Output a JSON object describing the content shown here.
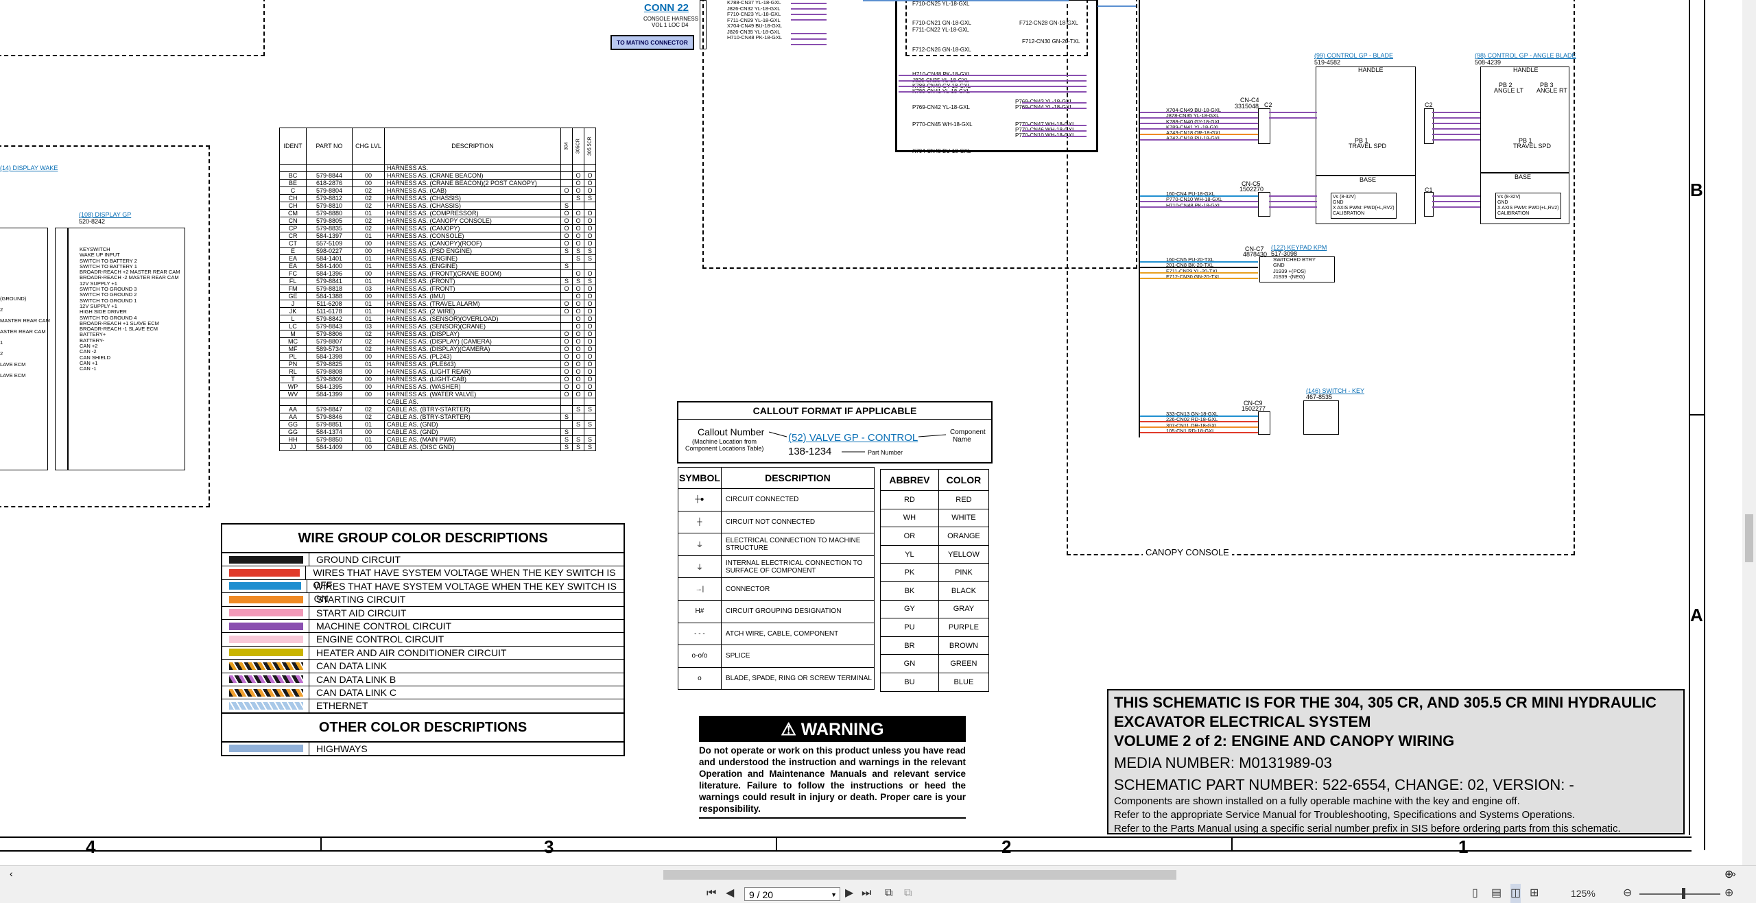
{
  "conn22": {
    "title": "CONN 22",
    "sub": [
      "CONSOLE HARNESS",
      "VOL 1 LOC D4"
    ],
    "button": "TO MATING CONNECTOR"
  },
  "mid_wires": [
    "F710-CN25 YL-18-GXL",
    "F710-CN21 GN-18-GXL",
    "F712-CN28 GN-18-GXL",
    "F711-CN22 YL-18-GXL",
    "F712-CN30 GN-20-TXL",
    "F712-CN26 GN-18-GXL",
    "H710-CN48 PK-18-GXL",
    "J826-CN35 YL-18-GXL",
    "K788-CN40 GY-18-GXL",
    "K789-CN41 YL-18-GXL",
    "P769-CN42 YL-18-GXL",
    "P769-CN43 YL-18-GXL",
    "P769-CN44 YL-18-GXL",
    "P770-CN45 WH-18-GXL",
    "P770-CN47 WH-18-GXL",
    "P770-CN46 WH-18-GXL",
    "P770-CN10 WH-18-GXL",
    "X704-CN49 BU-18-GXL"
  ],
  "conn22_wires": [
    "K788-CN37 YL-18-GXL",
    "J826-CN32 YL-18-GXL",
    "F710-CN23 YL-18-GXL",
    "F711-CN29 YL-18-GXL",
    "X704-CN49 BU-18-GXL",
    "J826-CN35 YL-18-GXL",
    "H710-CN48 PK-18-GXL"
  ],
  "blade": {
    "title": "(99) CONTROL GP - BLADE",
    "part": "519-4582",
    "handle": "HANDLE",
    "base": "BASE",
    "pb": "PB 1",
    "tsw": "TRAVEL SPD"
  },
  "angle": {
    "title": "(98) CONTROL GP - ANGLE BLADE",
    "part": "508-4239",
    "handle": "HANDLE",
    "base": "BASE",
    "pb2": "PB 2",
    "pb2b": "ANGLE LT",
    "pb3": "PB 3",
    "pb3b": "ANGLE RT",
    "pb1": "PB 1",
    "tsw": "TRAVEL SPD"
  },
  "base_lines": [
    "Vs (8-32V)",
    "GND",
    "X AXIS PWM: PWD(+L,RV2)",
    "CALIBRATION"
  ],
  "cn_c4": {
    "id": "CN-C4",
    "part": "3315048",
    "c": "C2",
    "wires": [
      "X704-CN49 BU-18-GXL",
      "J878-CN35 YL-18-GXL",
      "K788-CN40 GY-18-GXL",
      "K789-CN41 YL-18-GXL",
      "A743-CN18 OR-18-GXL",
      "A742-CN18 PU-18-GXL"
    ]
  },
  "cn_c5": {
    "id": "CN-C5",
    "part": "1502270",
    "c": "C1",
    "wires": [
      "160-CN4 PU-18-GXL",
      "P770-CN10 WH-18-GXL",
      "H710-CN48 PK-18-GXL"
    ]
  },
  "keypad": {
    "title": "(122) KEYPAD KPM",
    "part": "517-3098",
    "id": "CN-C7",
    "part2": "4878430",
    "wires": [
      "160-CN5 PU-20-TXL",
      "201-CN8 BK-20-TXL",
      "F711-CN29 YL-20-TXL",
      "F712-CN30 GN-20-TXL"
    ],
    "pins": [
      "SWITCHED BTRY",
      "GND",
      "J1939 +(POS)",
      "J1939 -(NEG)"
    ]
  },
  "key": {
    "title": "(146) SWITCH - KEY",
    "part": "467-8535",
    "id": "CN-C9",
    "part2": "1502277",
    "wires": [
      "333-CN13 GN-18-GXL",
      "226-CN02 RD-18-GXL",
      "307-CN11 OR-18-GXL",
      "105-CN1 RD-18-GXL"
    ]
  },
  "canopy_label": "CANOPY CONSOLE",
  "left_panel": {
    "wake": "(14) DISPLAY WAKE",
    "display_title": "(108) DISPLAY GP",
    "display_part": "520-8242",
    "pins": [
      "KEYSWITCH",
      "WAKE UP INPUT",
      "SWITCH TO BATTERY 2",
      "SWITCH TO BATTERY 1",
      "BROADR-REACH +2 MASTER REAR CAM",
      "BROADR-REACH -2 MASTER REAR CAM",
      "12V SUPPLY +1",
      "SWITCH TO GROUND 3",
      "SWITCH TO GROUND 2",
      "SWITCH TO GROUND 1",
      "12V SUPPLY +1",
      "HIGH SIDE DRIVER",
      "SWITCH TO GROUND 4",
      "BROADR-REACH +1 SLAVE ECM",
      "BROADR-REACH -1 SLAVE ECM",
      "BATTERY+",
      "BATTERY-",
      "CAN +2",
      "CAN -2",
      "CAN SHIELD",
      "CAN +1",
      "CAN -1"
    ],
    "left_frags": [
      "(GROUND)",
      "2",
      "MASTER REAR CAM",
      "ASTER REAR CAM",
      "1",
      "2",
      "LAVE ECM",
      "LAVE ECM"
    ]
  },
  "parts_table": {
    "headers": [
      "IDENT",
      "PART NO",
      "CHG LVL",
      "DESCRIPTION",
      "304",
      "305CR",
      "305.5CR"
    ],
    "rows": [
      [
        "",
        "",
        "",
        "HARNESS AS.",
        "",
        "",
        ""
      ],
      [
        "BC",
        "579-8844",
        "00",
        "HARNESS AS. (CRANE BEACON)",
        "",
        "O",
        "O"
      ],
      [
        "BE",
        "618-2876",
        "00",
        "HARNESS AS. (CRANE BEACON)(2 POST CANOPY)",
        "",
        "O",
        "O"
      ],
      [
        "C",
        "579-8804",
        "02",
        "HARNESS AS. (CAB)",
        "O",
        "O",
        "O"
      ],
      [
        "CH",
        "579-8812",
        "02",
        "HARNESS AS. (CHASSIS)",
        "",
        "S",
        "S"
      ],
      [
        "CH",
        "579-8810",
        "02",
        "HARNESS AS. (CHASSIS)",
        "S",
        "",
        ""
      ],
      [
        "CM",
        "579-8880",
        "01",
        "HARNESS AS. (COMPRESSOR)",
        "O",
        "O",
        "O"
      ],
      [
        "CN",
        "579-8805",
        "02",
        "HARNESS AS. (CANOPY CONSOLE)",
        "O",
        "O",
        "O"
      ],
      [
        "CP",
        "579-8835",
        "02",
        "HARNESS AS. (CANOPY)",
        "O",
        "O",
        "O"
      ],
      [
        "CR",
        "584-1397",
        "01",
        "HARNESS AS. (CONSOLE)",
        "O",
        "O",
        "O"
      ],
      [
        "CT",
        "557-5109",
        "00",
        "HARNESS AS. (CANOPY)(ROOF)",
        "O",
        "O",
        "O"
      ],
      [
        "E",
        "598-0227",
        "00",
        "HARNESS AS. (PSD ENGINE)",
        "S",
        "S",
        "S"
      ],
      [
        "EA",
        "584-1401",
        "01",
        "HARNESS AS. (ENGINE)",
        "",
        "S",
        "S"
      ],
      [
        "EA",
        "584-1400",
        "01",
        "HARNESS AS. (ENGINE)",
        "S",
        "",
        ""
      ],
      [
        "FC",
        "584-1396",
        "00",
        "HARNESS AS. (FRONT)(CRANE BOOM)",
        "",
        "O",
        "O"
      ],
      [
        "FL",
        "579-8841",
        "01",
        "HARNESS AS. (FRONT)",
        "S",
        "S",
        "S"
      ],
      [
        "FM",
        "579-8818",
        "03",
        "HARNESS AS. (FRONT)",
        "O",
        "O",
        "O"
      ],
      [
        "GE",
        "584-1388",
        "00",
        "HARNESS AS. (IMU)",
        "",
        "O",
        "O"
      ],
      [
        "J",
        "511-6208",
        "01",
        "HARNESS AS. (TRAVEL ALARM)",
        "O",
        "O",
        "O"
      ],
      [
        "JK",
        "511-6178",
        "01",
        "HARNESS AS. (2 WIRE)",
        "O",
        "O",
        "O"
      ],
      [
        "L",
        "579-8842",
        "01",
        "HARNESS AS. (SENSOR)(OVERLOAD)",
        "",
        "O",
        "O"
      ],
      [
        "LC",
        "579-8843",
        "03",
        "HARNESS AS. (SENSOR)(CRANE)",
        "",
        "O",
        "O"
      ],
      [
        "M",
        "579-8806",
        "02",
        "HARNESS AS. (DISPLAY)",
        "O",
        "O",
        "O"
      ],
      [
        "MC",
        "579-8807",
        "02",
        "HARNESS AS. (DISPLAY) (CAMERA)",
        "O",
        "O",
        "O"
      ],
      [
        "MF",
        "589-5734",
        "02",
        "HARNESS AS. (DISPLAY)(CAMERA)",
        "O",
        "O",
        "O"
      ],
      [
        "PL",
        "584-1398",
        "00",
        "HARNESS AS. (PL243)",
        "O",
        "O",
        "O"
      ],
      [
        "PN",
        "579-8825",
        "01",
        "HARNESS AS. (PLE643)",
        "O",
        "O",
        "O"
      ],
      [
        "RL",
        "579-8808",
        "00",
        "HARNESS AS. (LIGHT REAR)",
        "O",
        "O",
        "O"
      ],
      [
        "T",
        "579-8809",
        "00",
        "HARNESS AS. (LIGHT-CAB)",
        "O",
        "O",
        "O"
      ],
      [
        "WP",
        "584-1395",
        "00",
        "HARNESS AS. (WASHER)",
        "O",
        "O",
        "O"
      ],
      [
        "WV",
        "584-1399",
        "00",
        "HARNESS AS. (WATER VALVE)",
        "O",
        "O",
        "O"
      ],
      [
        "",
        "",
        "",
        "CABLE AS.",
        "",
        "",
        ""
      ],
      [
        "AA",
        "579-8847",
        "02",
        "CABLE AS. (BTRY-STARTER)",
        "",
        "S",
        "S"
      ],
      [
        "AA",
        "579-8846",
        "02",
        "CABLE AS. (BTRY-STARTER)",
        "S",
        "",
        ""
      ],
      [
        "GG",
        "579-8851",
        "01",
        "CABLE AS. (GND)",
        "",
        "S",
        "S"
      ],
      [
        "GG",
        "584-1374",
        "00",
        "CABLE AS. (GND)",
        "S",
        "",
        ""
      ],
      [
        "HH",
        "579-8850",
        "01",
        "CABLE AS. (MAIN PWR)",
        "S",
        "S",
        "S"
      ],
      [
        "JJ",
        "584-1409",
        "00",
        "CABLE AS. (DISC GND)",
        "S",
        "S",
        "S"
      ]
    ]
  },
  "wire_groups": {
    "title": "WIRE GROUP COLOR DESCRIPTIONS",
    "rows": [
      {
        "label": "GROUND CIRCUIT",
        "color": "#1a1a1a",
        "style": "solid"
      },
      {
        "label": "WIRES THAT HAVE SYSTEM VOLTAGE WHEN THE KEY SWITCH IS OFF",
        "color": "#e03a2a",
        "style": "solid"
      },
      {
        "label": "WIRES THAT HAVE SYSTEM VOLTAGE WHEN THE KEY SWITCH IS ON",
        "color": "#1f8fd0",
        "style": "solid"
      },
      {
        "label": "STARTING CIRCUIT",
        "color": "#f08a24",
        "style": "solid"
      },
      {
        "label": "START AID CIRCUIT",
        "color": "#f29ab8",
        "style": "solid"
      },
      {
        "label": "MACHINE CONTROL CIRCUIT",
        "color": "#8a4fb0",
        "style": "solid"
      },
      {
        "label": "ENGINE CONTROL CIRCUIT",
        "color": "#f8c8d8",
        "style": "solid"
      },
      {
        "label": "HEATER AND AIR CONDITIONER CIRCUIT",
        "color": "#c9b400",
        "style": "solid"
      },
      {
        "label": "CAN DATA LINK",
        "color": "#e8a020",
        "style": "stripe-a"
      },
      {
        "label": "CAN DATA LINK B",
        "color": "#c070d0",
        "style": "stripe-b"
      },
      {
        "label": "CAN DATA LINK C",
        "color": "#f0a030",
        "style": "stripe-c"
      },
      {
        "label": "ETHERNET",
        "color": "#a8c8e8",
        "style": "stripe-d"
      }
    ],
    "other_title": "OTHER COLOR DESCRIPTIONS",
    "other_rows": [
      {
        "label": "HIGHWAYS",
        "color": "#90b0d8",
        "style": "solid"
      }
    ]
  },
  "callout": {
    "title": "CALLOUT FORMAT IF APPLICABLE",
    "callout_number": "Callout Number",
    "callout_note": [
      "(Machine Location from",
      "Component Locations Table)"
    ],
    "sample": "(52) VALVE GP - CONTROL",
    "component_name": [
      "Component",
      "Name"
    ],
    "part": "138-1234",
    "part_label": "Part Number"
  },
  "symbols": {
    "headers": [
      "SYMBOL",
      "DESCRIPTION"
    ],
    "rows": [
      {
        "glyph": "┼●",
        "desc": "CIRCUIT CONNECTED"
      },
      {
        "glyph": "┼",
        "desc": "CIRCUIT NOT CONNECTED"
      },
      {
        "glyph": "⏚",
        "desc": "ELECTRICAL CONNECTION TO MACHINE STRUCTURE"
      },
      {
        "glyph": "⏚",
        "desc": "INTERNAL ELECTRICAL CONNECTION TO SURFACE OF COMPONENT"
      },
      {
        "glyph": "→|",
        "desc": "CONNECTOR"
      },
      {
        "glyph": "H#",
        "desc": "CIRCUIT GROUPING DESIGNATION"
      },
      {
        "glyph": "- - -",
        "desc": "ATCH WIRE, CABLE, COMPONENT"
      },
      {
        "glyph": "o-o/o",
        "desc": "SPLICE"
      },
      {
        "glyph": "o",
        "desc": "BLADE, SPADE, RING OR SCREW TERMINAL"
      }
    ]
  },
  "colors": {
    "headers": [
      "ABBREV",
      "COLOR"
    ],
    "rows": [
      [
        "RD",
        "RED"
      ],
      [
        "WH",
        "WHITE"
      ],
      [
        "OR",
        "ORANGE"
      ],
      [
        "YL",
        "YELLOW"
      ],
      [
        "PK",
        "PINK"
      ],
      [
        "BK",
        "BLACK"
      ],
      [
        "GY",
        "GRAY"
      ],
      [
        "PU",
        "PURPLE"
      ],
      [
        "BR",
        "BROWN"
      ],
      [
        "GN",
        "GREEN"
      ],
      [
        "BU",
        "BLUE"
      ]
    ]
  },
  "warning": {
    "title": "WARNING",
    "text": "Do not operate or work on this product unless you have read and understood the instruction and warnings in the relevant Operation and Maintenance Manuals and relevant service literature. Failure to follow the instructions or heed the warnings could result in injury or death. Proper care is your responsibility."
  },
  "title_block": {
    "line1": "THIS SCHEMATIC IS FOR THE 304, 305 CR, AND 305.5 CR MINI HYDRAULIC",
    "line2": "EXCAVATOR ELECTRICAL SYSTEM",
    "line3": "VOLUME 2 of 2: ENGINE AND CANOPY WIRING",
    "media": "MEDIA NUMBER: M0131989-03",
    "schematic": "SCHEMATIC PART NUMBER: 522-6554, CHANGE: 02, VERSION: -",
    "note1": "Components are shown installed on a fully operable machine with the key and engine off.",
    "note2": "Refer to the appropriate Service Manual for Troubleshooting, Specifications and Systems Operations.",
    "note3": "Refer to the Parts Manual using a specific serial number prefix in SIS before ordering parts from this schematic."
  },
  "grid": {
    "rows": [
      "B",
      "A"
    ],
    "cols": [
      "4",
      "3",
      "2",
      "1"
    ]
  },
  "viewer": {
    "page": "9 / 20",
    "zoom": "125%"
  }
}
